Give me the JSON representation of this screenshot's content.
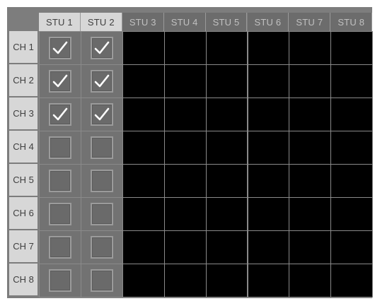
{
  "columns": [
    "STU 1",
    "STU 2",
    "STU 3",
    "STU 4",
    "STU 5",
    "STU 6",
    "STU 7",
    "STU 8"
  ],
  "active_columns": 2,
  "rows": [
    "CH 1",
    "CH 2",
    "CH 3",
    "CH 4",
    "CH 5",
    "CH 6",
    "CH 7",
    "CH 8"
  ],
  "checked": [
    [
      true,
      true
    ],
    [
      true,
      true
    ],
    [
      true,
      true
    ],
    [
      false,
      false
    ],
    [
      false,
      false
    ],
    [
      false,
      false
    ],
    [
      false,
      false
    ],
    [
      false,
      false
    ]
  ],
  "colors": {
    "grid_background": "#7d7d7d",
    "header_active": "#d7d7d7",
    "header_inactive": "#6c6c6c",
    "disabled_cell": "#000000",
    "checkmark": "#ffffff"
  },
  "icons": {
    "checked": "checkmark-icon"
  }
}
